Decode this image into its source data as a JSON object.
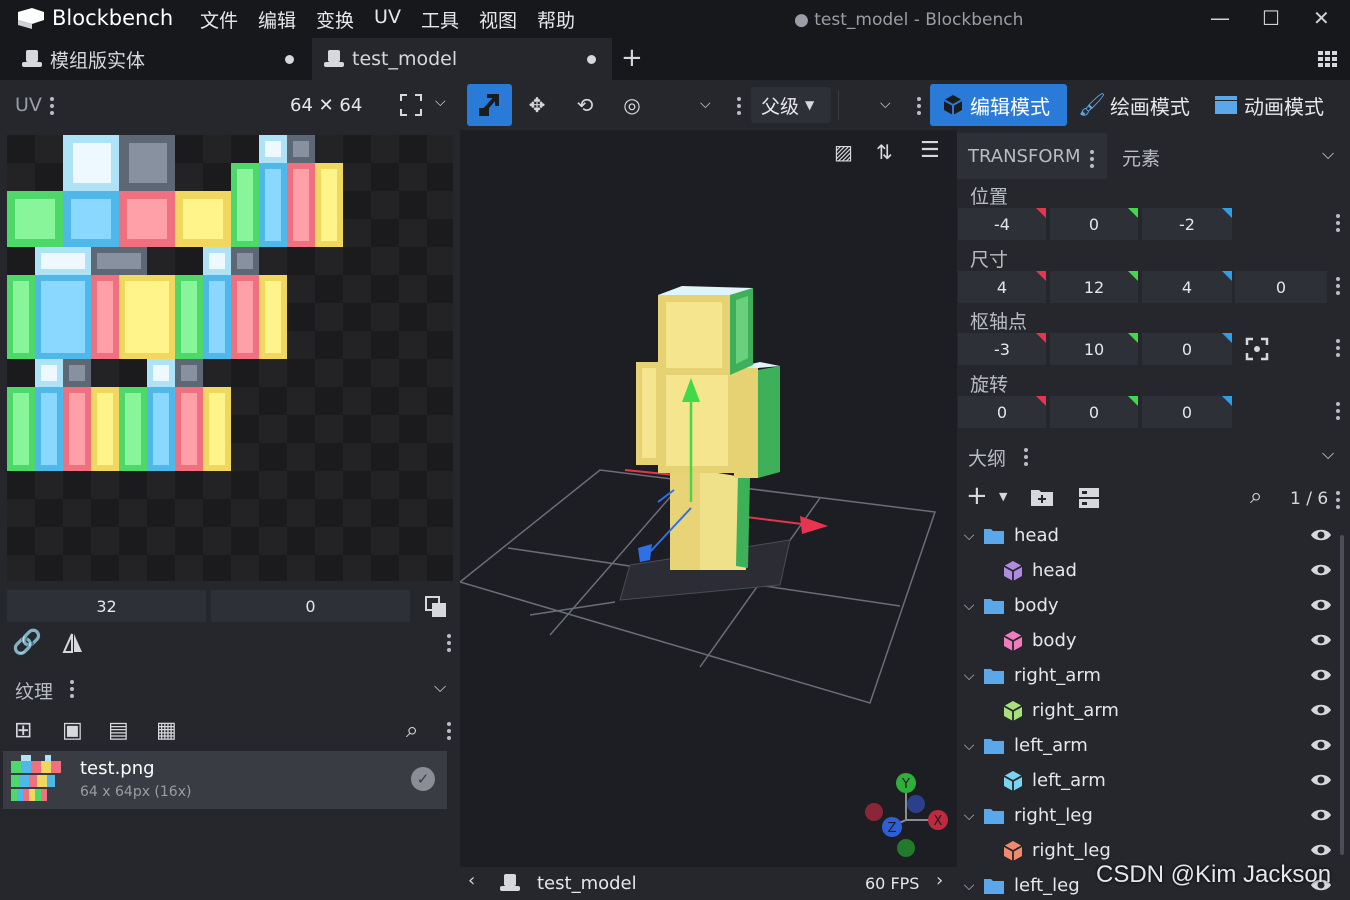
{
  "app": {
    "name": "Blockbench",
    "window_title": "test_model - Blockbench",
    "menu": [
      "文件",
      "编辑",
      "变换",
      "UV",
      "工具",
      "视图",
      "帮助"
    ]
  },
  "tabs": [
    {
      "label": "模组版实体"
    },
    {
      "label": "test_model"
    }
  ],
  "uv_panel": {
    "title": "UV",
    "size": "64 ✕ 64",
    "field_x": "32",
    "field_y": "0"
  },
  "toolbar": {
    "parent_select": "父级",
    "modes": [
      "编辑模式",
      "绘画模式",
      "动画模式"
    ]
  },
  "textures": {
    "title": "纹理",
    "items": [
      {
        "name": "test.png",
        "info": "64 x 64px (16x)"
      }
    ]
  },
  "viewport": {
    "model_name": "test_model",
    "fps": "60 FPS",
    "axes": [
      "X",
      "Y",
      "Z"
    ]
  },
  "transform": {
    "tab_transform": "TRANSFORM",
    "tab_elements": "元素",
    "position_label": "位置",
    "position": [
      "-4",
      "0",
      "-2"
    ],
    "size_label": "尺寸",
    "size": [
      "4",
      "12",
      "4",
      "0"
    ],
    "pivot_label": "枢轴点",
    "pivot": [
      "-3",
      "10",
      "0"
    ],
    "rotation_label": "旋转",
    "rotation": [
      "0",
      "0",
      "0"
    ]
  },
  "outliner": {
    "title": "大纲",
    "count": "1 / 6",
    "rows": [
      {
        "name": "head",
        "type": "group"
      },
      {
        "name": "head",
        "type": "cube",
        "color": "#b08be0"
      },
      {
        "name": "body",
        "type": "group"
      },
      {
        "name": "body",
        "type": "cube",
        "color": "#f07cc0"
      },
      {
        "name": "right_arm",
        "type": "group"
      },
      {
        "name": "right_arm",
        "type": "cube",
        "color": "#a8e07a"
      },
      {
        "name": "left_arm",
        "type": "group"
      },
      {
        "name": "left_arm",
        "type": "cube",
        "color": "#7ad4f0"
      },
      {
        "name": "right_leg",
        "type": "group"
      },
      {
        "name": "right_leg",
        "type": "cube",
        "color": "#f08a6a"
      },
      {
        "name": "left_leg",
        "type": "group"
      }
    ]
  },
  "watermark": "CSDN @Kim Jackson",
  "colors": {
    "accent": "#2a7bd8",
    "axis_x": "#e8344e",
    "axis_y": "#3fd94a",
    "axis_z": "#2f6fe8",
    "folder": "#5aa8ea"
  }
}
